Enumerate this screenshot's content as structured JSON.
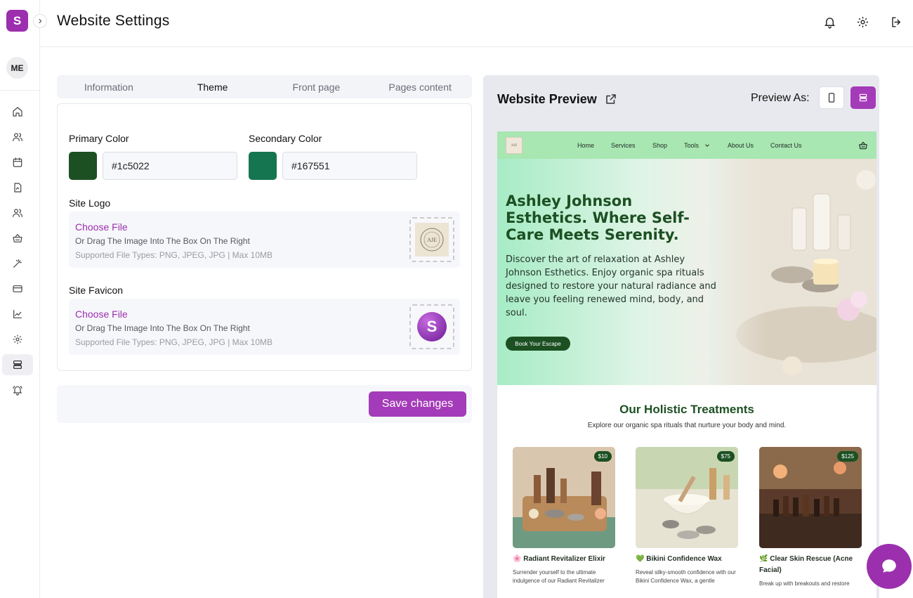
{
  "brand": {
    "initial": "S"
  },
  "user": {
    "initials": "ME"
  },
  "sidebar": {
    "items": [
      {
        "icon": "home-icon"
      },
      {
        "icon": "users-icon"
      },
      {
        "icon": "calendar-icon"
      },
      {
        "icon": "document-icon"
      },
      {
        "icon": "team-icon"
      },
      {
        "icon": "basket-icon"
      },
      {
        "icon": "magic-wand-icon"
      },
      {
        "icon": "credit-card-icon"
      },
      {
        "icon": "chart-icon"
      },
      {
        "icon": "gear-icon"
      },
      {
        "icon": "website-icon",
        "active": true
      },
      {
        "icon": "bell-ring-icon"
      }
    ]
  },
  "header": {
    "title": "Website Settings"
  },
  "tabs": [
    {
      "label": "Information"
    },
    {
      "label": "Theme",
      "active": true
    },
    {
      "label": "Front page"
    },
    {
      "label": "Pages content"
    }
  ],
  "theme": {
    "primary_label": "Primary Color",
    "primary_value": "#1c5022",
    "secondary_label": "Secondary Color",
    "secondary_value": "#167551",
    "logo": {
      "label": "Site Logo",
      "choose": "Choose File",
      "hint": "Or Drag The Image Into The Box On The Right",
      "types": "Supported File Types: PNG, JPEG, JPG | Max 10MB"
    },
    "favicon": {
      "label": "Site Favicon",
      "choose": "Choose File",
      "hint": "Or Drag The Image Into The Box On The Right",
      "types": "Supported File Types: PNG, JPEG, JPG | Max 10MB",
      "letter": "S"
    },
    "save_label": "Save changes"
  },
  "preview": {
    "title": "Website Preview",
    "preview_as": "Preview As:",
    "site": {
      "logo_text": "AJE",
      "nav": [
        "Home",
        "Services",
        "Shop",
        "Tools",
        "About Us",
        "Contact Us"
      ],
      "hero_title": "Ashley Johnson Esthetics. Where Self-Care Meets Serenity.",
      "hero_text": "Discover the art of relaxation at Ashley Johnson Esthetics. Enjoy organic spa rituals designed to restore your natural radiance and leave you feeling renewed mind, body, and soul.",
      "hero_button": "Book Your Escape",
      "section_title": "Our Holistic Treatments",
      "section_sub": "Explore our organic spa rituals that nurture your body and mind.",
      "products": [
        {
          "price": "$10",
          "name": "🌸 Radiant Revitalizer Elixir",
          "desc": "Surrender yourself to the ultimate indulgence of our Radiant Revitalizer"
        },
        {
          "price": "$75",
          "name": "💚 Bikini Confidence Wax",
          "desc": "Reveal silky-smooth confidence with our Bikini Confidence Wax, a gentle"
        },
        {
          "price": "$125",
          "name": "🌿 Clear Skin Rescue (Acne Facial)",
          "desc": "Break up with breakouts and restore"
        }
      ]
    }
  },
  "colors": {
    "accent": "#9b2fae",
    "primary": "#1c5022",
    "secondary": "#167551",
    "site_nav": "#a8e6b2"
  }
}
